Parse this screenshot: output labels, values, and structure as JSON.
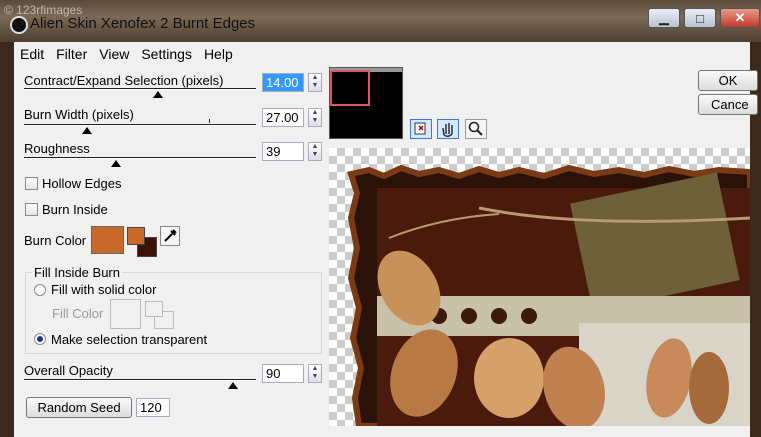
{
  "watermark": "© 123rfimages",
  "window": {
    "title": "Alien Skin Xenofex 2 Burnt Edges",
    "minimize": "▁",
    "maximize": "□",
    "close": "✕"
  },
  "menu": [
    "Edit",
    "Filter",
    "View",
    "Settings",
    "Help"
  ],
  "params": {
    "contract": {
      "label": "Contract/Expand Selection (pixels)",
      "value": "14.00",
      "level": 0.5
    },
    "width": {
      "label": "Burn Width (pixels)",
      "value": "27.00",
      "level": 0.27
    },
    "roughness": {
      "label": "Roughness",
      "value": "39",
      "level": 0.39
    }
  },
  "hollow_edges": {
    "label": "Hollow Edges",
    "checked": false
  },
  "burn_inside": {
    "label": "Burn Inside",
    "checked": false
  },
  "burn_color": {
    "label": "Burn Color",
    "value": "#c8682a"
  },
  "fill_inside": {
    "title": "Fill Inside Burn",
    "solid_label": "Fill with solid color",
    "fill_color_label": "Fill Color",
    "transparent_label": "Make selection transparent",
    "selected": "transparent"
  },
  "opacity": {
    "label": "Overall Opacity",
    "value": "90",
    "level": 0.9
  },
  "random_seed": {
    "button": "Random Seed",
    "value": "120"
  },
  "actions": {
    "ok": "OK",
    "cancel": "Cance"
  },
  "icons": [
    "preview-toggle-icon",
    "hand-icon",
    "zoom-icon"
  ],
  "colors": {
    "accent": "#3399ff",
    "burn": "#c8682a",
    "burn_dark": "#3a1408"
  }
}
